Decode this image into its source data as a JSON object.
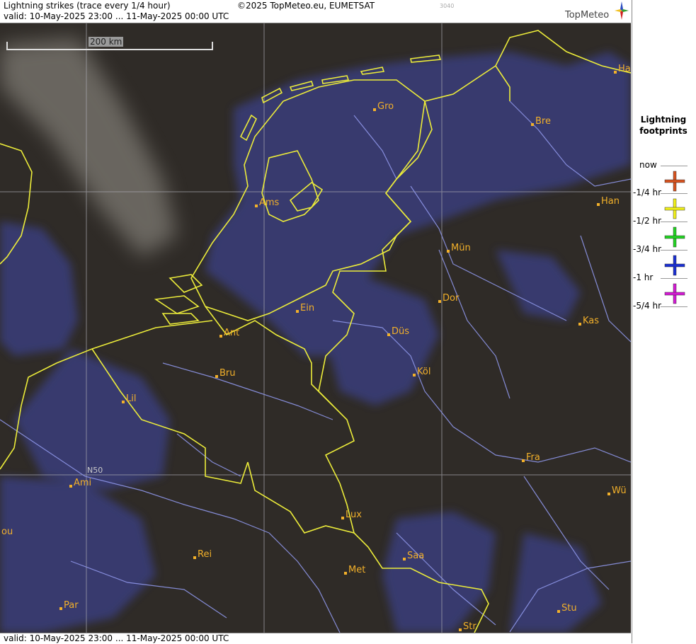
{
  "header": {
    "title": "Lightning strikes (trace every 1/4 hour)",
    "valid": "valid:  10-May-2025 23:00 ... 11-May-2025 00:00 UTC",
    "copyright": "©2025 TopMeteo.eu, EUMETSAT",
    "small_code": "3040",
    "logo_text": "TopMeteo"
  },
  "footer": {
    "valid": "valid:  10-May-2025 23:00 ... 11-May-2025 00:00 UTC"
  },
  "map": {
    "scale_label": "200 km",
    "lat_label": "N50",
    "cities": [
      {
        "name": "Gro"
      },
      {
        "name": "Bre"
      },
      {
        "name": "Ha"
      },
      {
        "name": "Ams"
      },
      {
        "name": "Han"
      },
      {
        "name": "Mün"
      },
      {
        "name": "Dor"
      },
      {
        "name": "Ein"
      },
      {
        "name": "Ant"
      },
      {
        "name": "Düs"
      },
      {
        "name": "Kas"
      },
      {
        "name": "Bru"
      },
      {
        "name": "Köl"
      },
      {
        "name": "Lil"
      },
      {
        "name": "Fra"
      },
      {
        "name": "Ami"
      },
      {
        "name": "Wü"
      },
      {
        "name": "Lux"
      },
      {
        "name": "ou"
      },
      {
        "name": "Rei"
      },
      {
        "name": "Saa"
      },
      {
        "name": "Met"
      },
      {
        "name": "Par"
      },
      {
        "name": "Stu"
      },
      {
        "name": "Str"
      }
    ]
  },
  "legend": {
    "title_line1": "Lightning",
    "title_line2": "footprints",
    "rows": [
      {
        "label": "now",
        "color": "#d9531e"
      },
      {
        "label": "-1/4 hr",
        "color": "#f2f21a"
      },
      {
        "label": "-1/2 hr",
        "color": "#22d422"
      },
      {
        "label": "-3/4 hr",
        "color": "#1a2fd4"
      },
      {
        "label": "-1 hr",
        "color": "#d41ad4"
      },
      {
        "label": "-5/4 hr",
        "color": ""
      }
    ]
  }
}
